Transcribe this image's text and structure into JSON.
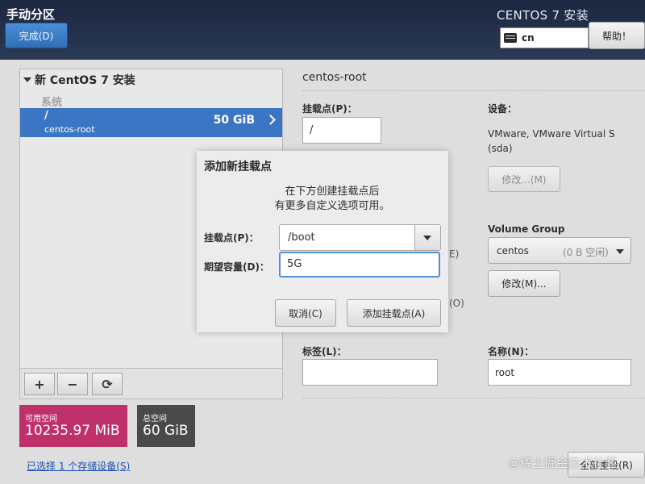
{
  "header": {
    "title": "手动分区",
    "done_button": "完成(D)",
    "install_title": "CENTOS 7 安装",
    "keyboard_layout": "cn",
    "help_button": "帮助！"
  },
  "left_panel": {
    "section_header": "新 CentOS 7 安装",
    "group_label": "系统",
    "selected_row": {
      "mount_point": "/",
      "name": "centos-root",
      "size": "50 GiB"
    },
    "toolbar": {
      "add": "+",
      "remove": "−",
      "refresh": "⟳"
    }
  },
  "space": {
    "available_label": "可用空间",
    "available_value": "10235.97 MiB",
    "total_label": "总空间",
    "total_value": "60 GiB"
  },
  "storage_link": "已选择 1 个存储设备(S)",
  "details": {
    "title": "centos-root",
    "mount_point_label": "挂载点(P)：",
    "mount_point_value": "/",
    "partial_e": "E)",
    "partial_o": "(O)",
    "device_label": "设备：",
    "device_value": "VMware, VMware Virtual S (sda)",
    "modify_button_1": "修改...(M)",
    "volume_group_label": "Volume Group",
    "volume_group_value": "centos",
    "volume_group_free": "(0 B 空闲)",
    "modify_button_2": "修改(M)...",
    "label_label": "标签(L)：",
    "label_value": "",
    "name_label": "名称(N)：",
    "name_value": "root",
    "reset_button": "全部重设(R)"
  },
  "dialog": {
    "title": "添加新挂载点",
    "description_line1": "在下方创建挂载点后",
    "description_line2": "有更多自定义选项可用。",
    "mount_point_label": "挂载点(P)：",
    "mount_point_value": "/boot",
    "capacity_label": "期望容量(D)：",
    "capacity_value": "5G",
    "cancel_button": "取消(C)",
    "add_button": "添加挂载点(A)"
  },
  "watermark": "@稀土掘金技术社区"
}
